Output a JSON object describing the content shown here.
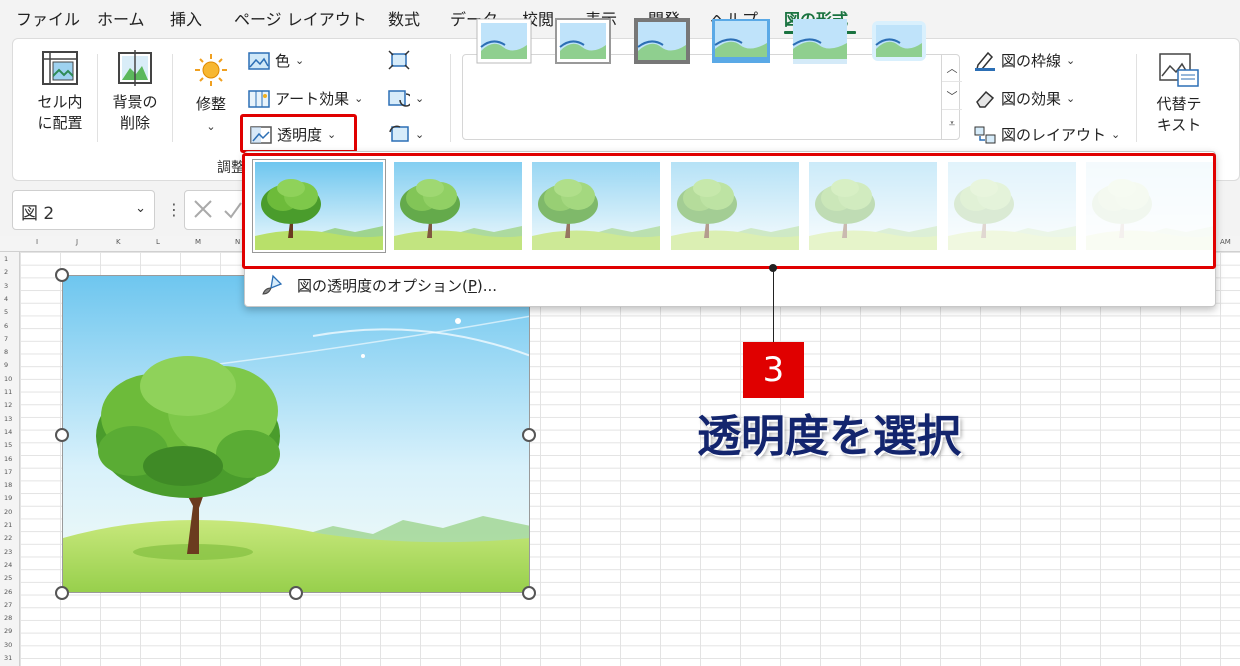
{
  "menu": {
    "tabs": [
      "ファイル",
      "ホーム",
      "挿入",
      "ページ レイアウト",
      "数式",
      "データ",
      "校閲",
      "表示",
      "開発",
      "ヘルプ",
      "図の形式"
    ],
    "active_tab": "図の形式"
  },
  "ribbon": {
    "cell_place": {
      "line1": "セル内",
      "line2": "に配置",
      "icon": "picture-in-cell-icon"
    },
    "remove_bg": {
      "line1": "背景の",
      "line2": "削除",
      "icon": "remove-background-icon"
    },
    "corrections": {
      "label": "修整",
      "icon": "sun-icon"
    },
    "color": {
      "label": "色",
      "icon": "color-icon"
    },
    "art_effects": {
      "label": "アート効果",
      "icon": "art-effects-icon"
    },
    "transparency": {
      "label": "透明度",
      "icon": "transparency-icon"
    },
    "compress_icon": "compress-picture-icon",
    "change_icon": "change-picture-icon",
    "reset_icon": "reset-picture-icon",
    "group_adjust": "調整",
    "picture_border": {
      "label": "図の枠線",
      "icon": "pen-icon"
    },
    "picture_effects": {
      "label": "図の効果",
      "icon": "eraser-icon"
    },
    "picture_layout": {
      "label": "図のレイアウト",
      "icon": "layout-icon"
    },
    "alt_text": {
      "line1": "代替テ",
      "line2": "キスト",
      "icon": "alt-text-icon"
    }
  },
  "namebox": {
    "value": "図 2"
  },
  "sheet": {
    "columns": [
      "I",
      "J",
      "K",
      "L",
      "M",
      "N",
      "AM"
    ],
    "rows": [
      "1",
      "2",
      "3",
      "4",
      "5",
      "6",
      "7",
      "8",
      "9",
      "10",
      "11",
      "12",
      "13",
      "14",
      "15",
      "16",
      "17",
      "18",
      "19",
      "20",
      "21",
      "22",
      "23",
      "24",
      "25",
      "26",
      "27",
      "28",
      "29",
      "30",
      "31"
    ]
  },
  "transparency_menu": {
    "presets": [
      {
        "name": "transparency-0",
        "opacity": 1.0
      },
      {
        "name": "transparency-15",
        "opacity": 0.85
      },
      {
        "name": "transparency-30",
        "opacity": 0.7
      },
      {
        "name": "transparency-50",
        "opacity": 0.5
      },
      {
        "name": "transparency-65",
        "opacity": 0.35
      },
      {
        "name": "transparency-80",
        "opacity": 0.2
      },
      {
        "name": "transparency-95",
        "opacity": 0.07
      }
    ],
    "options_label_prefix": "図の透明度のオプション(",
    "options_hotkey": "P",
    "options_label_suffix": ")..."
  },
  "annotation": {
    "step": "3",
    "text": "透明度を選択"
  },
  "colors": {
    "accent_green": "#1a7340",
    "highlight_red": "#e00000",
    "annotation_navy": "#13256e"
  }
}
